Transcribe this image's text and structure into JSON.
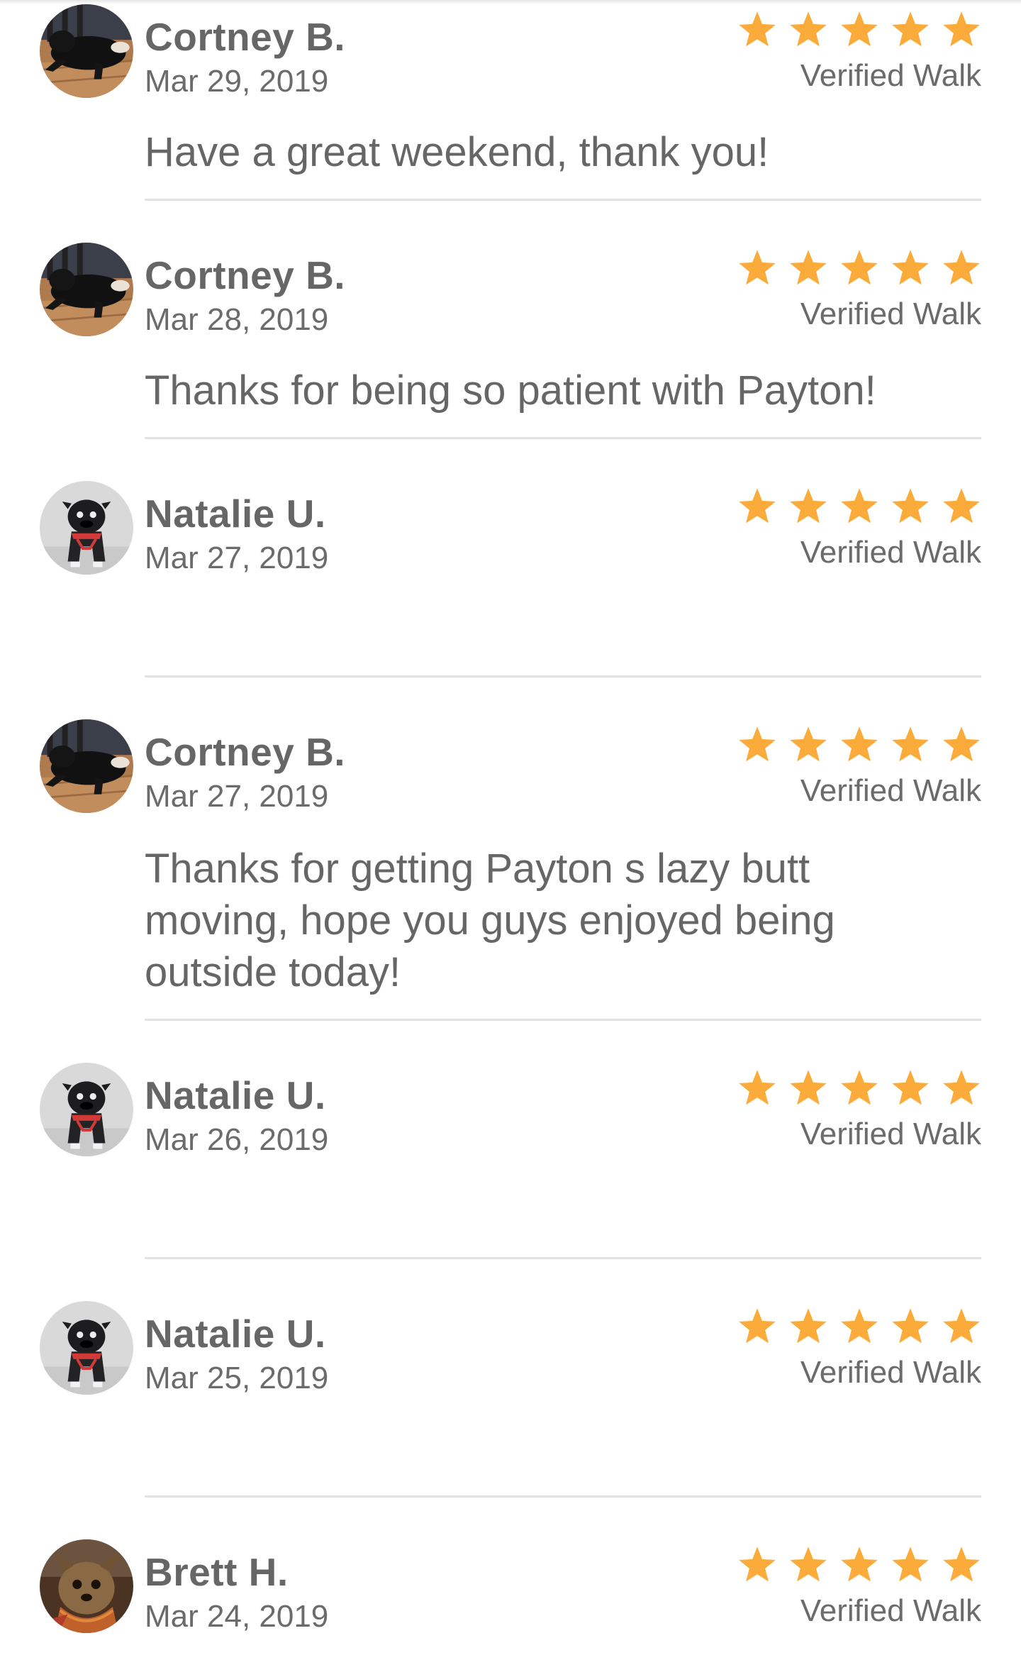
{
  "reviews": [
    {
      "reviewer": "Cortney B.",
      "avatar_icon": "black-dog-on-floor-avatar-icon",
      "date": "Mar 29, 2019",
      "rating": 5,
      "verified_label": "Verified Walk",
      "text": "Have a great weekend, thank you!"
    },
    {
      "reviewer": "Cortney B.",
      "avatar_icon": "black-dog-on-floor-avatar-icon",
      "date": "Mar 28, 2019",
      "rating": 5,
      "verified_label": "Verified Walk",
      "text": "Thanks for being so patient with Payton!"
    },
    {
      "reviewer": "Natalie U.",
      "avatar_icon": "pug-avatar-icon",
      "date": "Mar 27, 2019",
      "rating": 5,
      "verified_label": "Verified Walk",
      "text": ""
    },
    {
      "reviewer": "Cortney B.",
      "avatar_icon": "black-dog-on-floor-avatar-icon",
      "date": "Mar 27, 2019",
      "rating": 5,
      "verified_label": "Verified Walk",
      "text": "Thanks for getting Payton s lazy butt moving, hope you guys enjoyed being outside today!"
    },
    {
      "reviewer": "Natalie U.",
      "avatar_icon": "pug-avatar-icon",
      "date": "Mar 26, 2019",
      "rating": 5,
      "verified_label": "Verified Walk",
      "text": ""
    },
    {
      "reviewer": "Natalie U.",
      "avatar_icon": "pug-avatar-icon",
      "date": "Mar 25, 2019",
      "rating": 5,
      "verified_label": "Verified Walk",
      "text": ""
    },
    {
      "reviewer": "Brett H.",
      "avatar_icon": "small-dog-avatar-icon",
      "date": "Mar 24, 2019",
      "rating": 5,
      "verified_label": "Verified Walk",
      "text": ""
    }
  ],
  "colors": {
    "star": "#fbab3a",
    "text": "#666666",
    "divider": "#e3e3e3"
  },
  "icons": {
    "star": "star-icon"
  }
}
